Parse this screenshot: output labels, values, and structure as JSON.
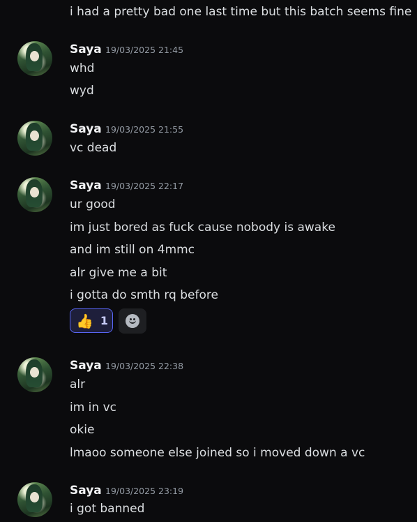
{
  "channel": {
    "prev_message": "i had a pretty bad one last time but this batch seems fine",
    "groups": [
      {
        "username": "Saya",
        "timestamp": "19/03/2025 21:45",
        "lines": [
          "whd",
          "wyd"
        ]
      },
      {
        "username": "Saya",
        "timestamp": "19/03/2025 21:55",
        "lines": [
          "vc dead"
        ]
      },
      {
        "username": "Saya",
        "timestamp": "19/03/2025 22:17",
        "lines": [
          "ur good",
          "im just bored as fuck cause nobody is awake",
          "and im still on 4mmc",
          "alr give me a bit",
          "i gotta do smth rq before"
        ],
        "reaction": {
          "emoji": "👍",
          "count": "1",
          "icon": "thumbs-up-icon"
        },
        "add_reaction_icon": "smile-icon"
      },
      {
        "username": "Saya",
        "timestamp": "19/03/2025 22:38",
        "lines": [
          "alr",
          "im in vc",
          "okie",
          "lmaoo someone else joined so i moved down a vc"
        ]
      },
      {
        "username": "Saya",
        "timestamp": "19/03/2025 23:19",
        "lines": [
          "i got banned"
        ]
      }
    ]
  },
  "colors": {
    "background": "#0b0b0d",
    "text": "#dbdee1",
    "username": "#f2f3f5",
    "timestamp": "#949ba4",
    "reaction_border": "#5865f2"
  }
}
